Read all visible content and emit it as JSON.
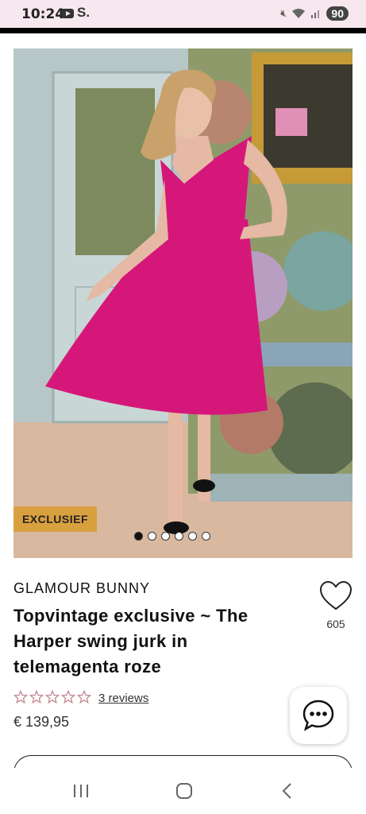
{
  "status_bar": {
    "time": "10:24",
    "battery": "90",
    "icons": [
      "youtube-icon",
      "s-app-icon",
      "mute-icon",
      "wifi-icon",
      "signal-icon"
    ]
  },
  "product": {
    "badge": "EXCLUSIEF",
    "brand": "GLAMOUR BUNNY",
    "title": "Topvintage exclusive ~ The Harper swing jurk in telemagenta roze",
    "favorites_count": "605",
    "reviews_link": "3 reviews",
    "rating": 0,
    "price": "€ 139,95",
    "image_count": 6,
    "active_image_index": 0
  },
  "colors": {
    "accent_badge": "#d9a040",
    "dress_magenta": "#d6177a",
    "star_outline": "#c2848f"
  }
}
